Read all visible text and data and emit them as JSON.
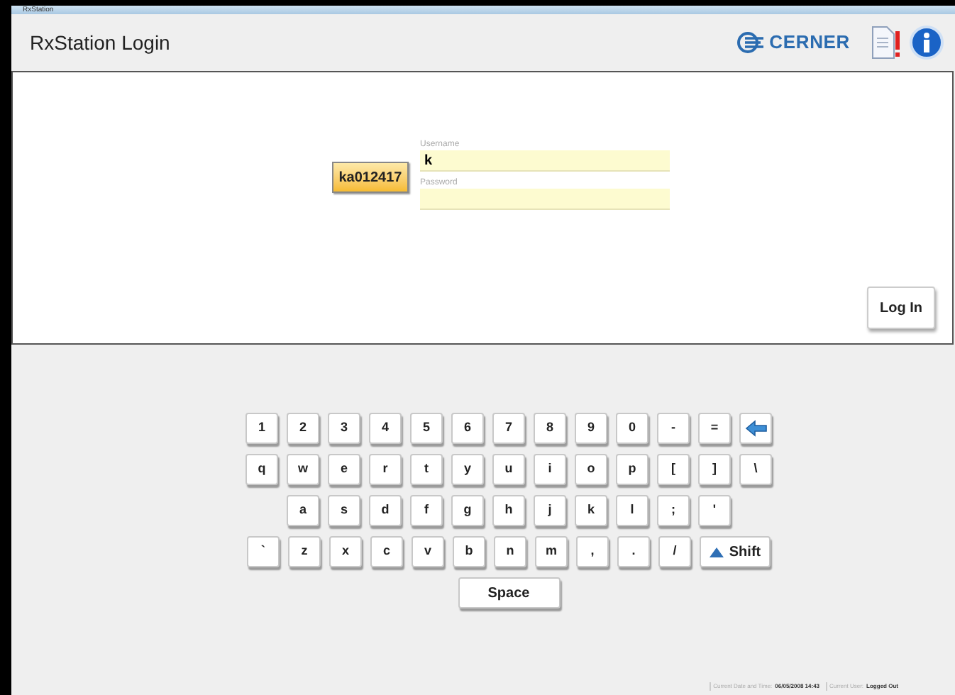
{
  "window": {
    "title": "RxStation"
  },
  "header": {
    "title": "RxStation Login",
    "logo_text": "CERNER"
  },
  "login": {
    "badge": "ka012417",
    "username": {
      "label": "Username",
      "value": "k"
    },
    "password": {
      "label": "Password"
    },
    "button": "Log In"
  },
  "keyboard": {
    "rows": [
      {
        "keys": [
          {
            "kind": "char",
            "label": "1"
          },
          {
            "kind": "char",
            "label": "2"
          },
          {
            "kind": "char",
            "label": "3"
          },
          {
            "kind": "char",
            "label": "4"
          },
          {
            "kind": "char",
            "label": "5"
          },
          {
            "kind": "char",
            "label": "6"
          },
          {
            "kind": "char",
            "label": "7"
          },
          {
            "kind": "char",
            "label": "8"
          },
          {
            "kind": "char",
            "label": "9"
          },
          {
            "kind": "char",
            "label": "0"
          },
          {
            "kind": "char",
            "label": "-"
          },
          {
            "kind": "char",
            "label": "="
          },
          {
            "kind": "backspace"
          }
        ]
      },
      {
        "keys": [
          {
            "kind": "char",
            "label": "q"
          },
          {
            "kind": "char",
            "label": "w"
          },
          {
            "kind": "char",
            "label": "e"
          },
          {
            "kind": "char",
            "label": "r"
          },
          {
            "kind": "char",
            "label": "t"
          },
          {
            "kind": "char",
            "label": "y"
          },
          {
            "kind": "char",
            "label": "u"
          },
          {
            "kind": "char",
            "label": "i"
          },
          {
            "kind": "char",
            "label": "o"
          },
          {
            "kind": "char",
            "label": "p"
          },
          {
            "kind": "char",
            "label": "["
          },
          {
            "kind": "char",
            "label": "]"
          },
          {
            "kind": "char",
            "label": "\\"
          }
        ]
      },
      {
        "keys": [
          {
            "kind": "char",
            "label": "a"
          },
          {
            "kind": "char",
            "label": "s"
          },
          {
            "kind": "char",
            "label": "d"
          },
          {
            "kind": "char",
            "label": "f"
          },
          {
            "kind": "char",
            "label": "g"
          },
          {
            "kind": "char",
            "label": "h"
          },
          {
            "kind": "char",
            "label": "j"
          },
          {
            "kind": "char",
            "label": "k"
          },
          {
            "kind": "char",
            "label": "l"
          },
          {
            "kind": "char",
            "label": ";"
          },
          {
            "kind": "char",
            "label": "'"
          }
        ]
      },
      {
        "keys": [
          {
            "kind": "char",
            "label": "`"
          },
          {
            "kind": "char",
            "label": "z"
          },
          {
            "kind": "char",
            "label": "x"
          },
          {
            "kind": "char",
            "label": "c"
          },
          {
            "kind": "char",
            "label": "v"
          },
          {
            "kind": "char",
            "label": "b"
          },
          {
            "kind": "char",
            "label": "n"
          },
          {
            "kind": "char",
            "label": "m"
          },
          {
            "kind": "char",
            "label": ","
          },
          {
            "kind": "char",
            "label": "."
          },
          {
            "kind": "char",
            "label": "/"
          },
          {
            "kind": "shift",
            "label": "Shift"
          }
        ]
      },
      {
        "keys": [
          {
            "kind": "space",
            "label": "Space"
          }
        ]
      }
    ]
  },
  "status_bar": [
    {
      "label": "Current Date and Time:",
      "value": "06/05/2008 14:43"
    },
    {
      "label": "Current User:",
      "value": "Logged Out"
    }
  ]
}
